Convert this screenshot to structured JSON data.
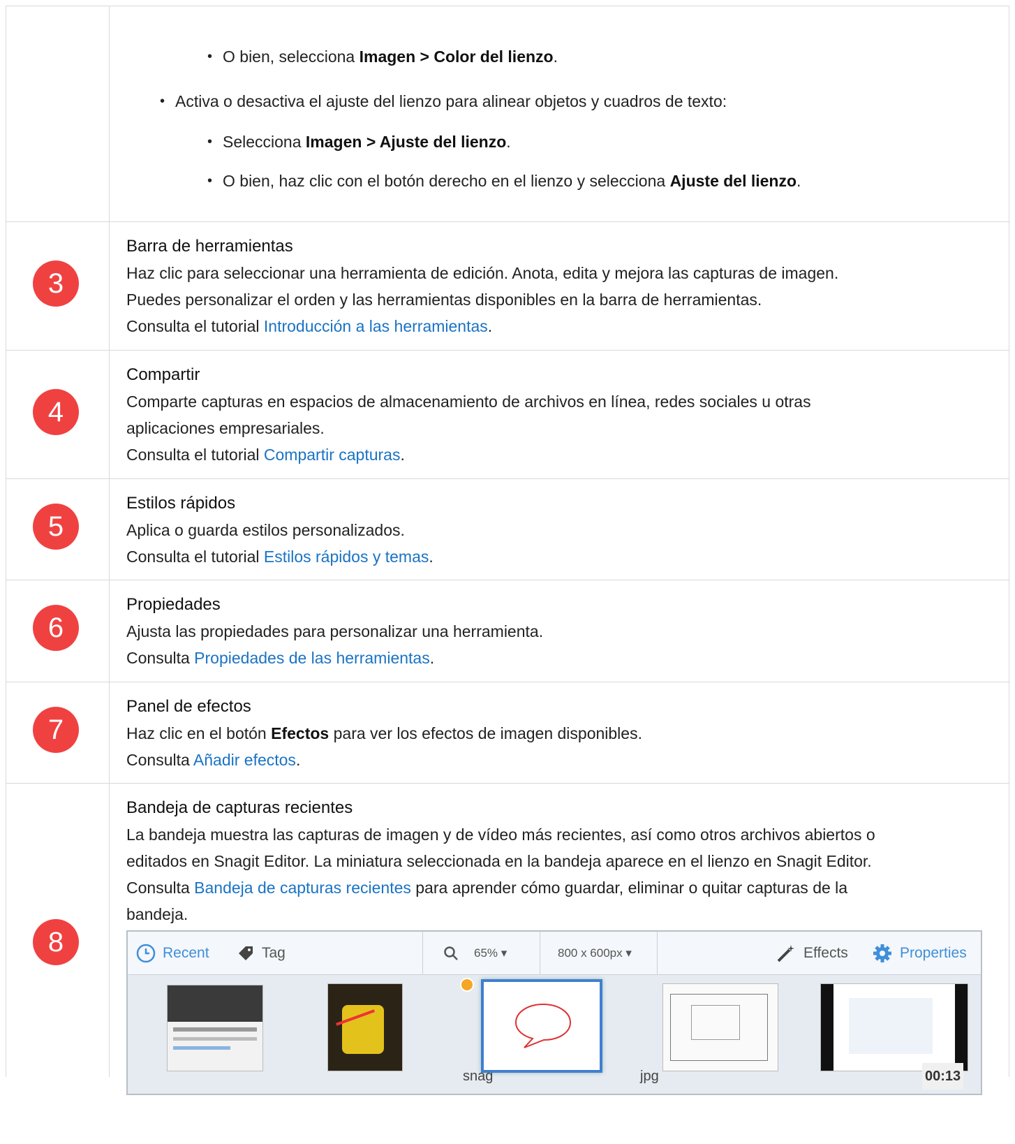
{
  "rows": [
    {
      "bullets": [
        {
          "level": 2,
          "text_before": "O bien, selecciona ",
          "bold": "Imagen > Color del lienzo",
          "text_after": "."
        },
        {
          "level": 1,
          "text_before": "Activa o desactiva el ajuste del lienzo para alinear objetos y cuadros de texto:",
          "bold": "",
          "text_after": ""
        },
        {
          "level": 2,
          "text_before": "Selecciona ",
          "bold": "Imagen > Ajuste del lienzo",
          "text_after": "."
        },
        {
          "level": 2,
          "text_before": "O bien, haz clic con el botón derecho en el lienzo y selecciona ",
          "bold": "Ajuste del lienzo",
          "text_after": "."
        }
      ]
    },
    {
      "number": "3",
      "title": "Barra de herramientas",
      "lines": [
        "Haz clic para seleccionar una herramienta de edición. Anota, edita y mejora las capturas de imagen.",
        "Puedes personalizar el orden y las herramientas disponibles en la barra de herramientas."
      ],
      "ref_prefix": "Consulta el tutorial ",
      "link": "Introducción a las herramientas",
      "ref_suffix": "."
    },
    {
      "number": "4",
      "title": "Compartir",
      "lines": [
        "Comparte capturas en espacios de almacenamiento de archivos en línea, redes sociales u otras",
        "aplicaciones empresariales."
      ],
      "ref_prefix": "Consulta el tutorial ",
      "link": "Compartir capturas",
      "ref_suffix": "."
    },
    {
      "number": "5",
      "title": "Estilos rápidos",
      "lines": [
        "Aplica o guarda estilos personalizados."
      ],
      "ref_prefix": "Consulta el tutorial ",
      "link": "Estilos rápidos y temas",
      "ref_suffix": "."
    },
    {
      "number": "6",
      "title": "Propiedades",
      "lines": [
        "Ajusta las propiedades para personalizar una herramienta."
      ],
      "ref_prefix": "Consulta ",
      "link": "Propiedades de las herramientas",
      "ref_suffix": "."
    },
    {
      "number": "7",
      "title": "Panel de efectos",
      "line_before": "Haz clic en el botón ",
      "line_bold": "Efectos",
      "line_after": " para ver los efectos de imagen disponibles.",
      "ref_prefix": "Consulta ",
      "link": "Añadir efectos",
      "ref_suffix": "."
    },
    {
      "number": "8",
      "title": "Bandeja de capturas recientes",
      "lines": [
        "La bandeja muestra las capturas de imagen y de vídeo más recientes, así como otros archivos abiertos o",
        "editados en Snagit Editor. La miniatura seleccionada en la bandeja aparece en el lienzo en Snagit Editor."
      ],
      "ref_prefix": "Consulta ",
      "link": "Bandeja de capturas recientes",
      "ref_suffix": " para aprender cómo guardar, eliminar o quitar capturas de la",
      "ref_line2": "bandeja."
    }
  ],
  "tray": {
    "recent": "Recent",
    "tag": "Tag",
    "zoom": "65% ▾",
    "size": "800 x 600px ▾",
    "effects": "Effects",
    "properties": "Properties",
    "labels": [
      "snag",
      "jpg",
      "00:13"
    ]
  },
  "colors": {
    "badge": "#f04141",
    "link": "#1a73c4"
  }
}
